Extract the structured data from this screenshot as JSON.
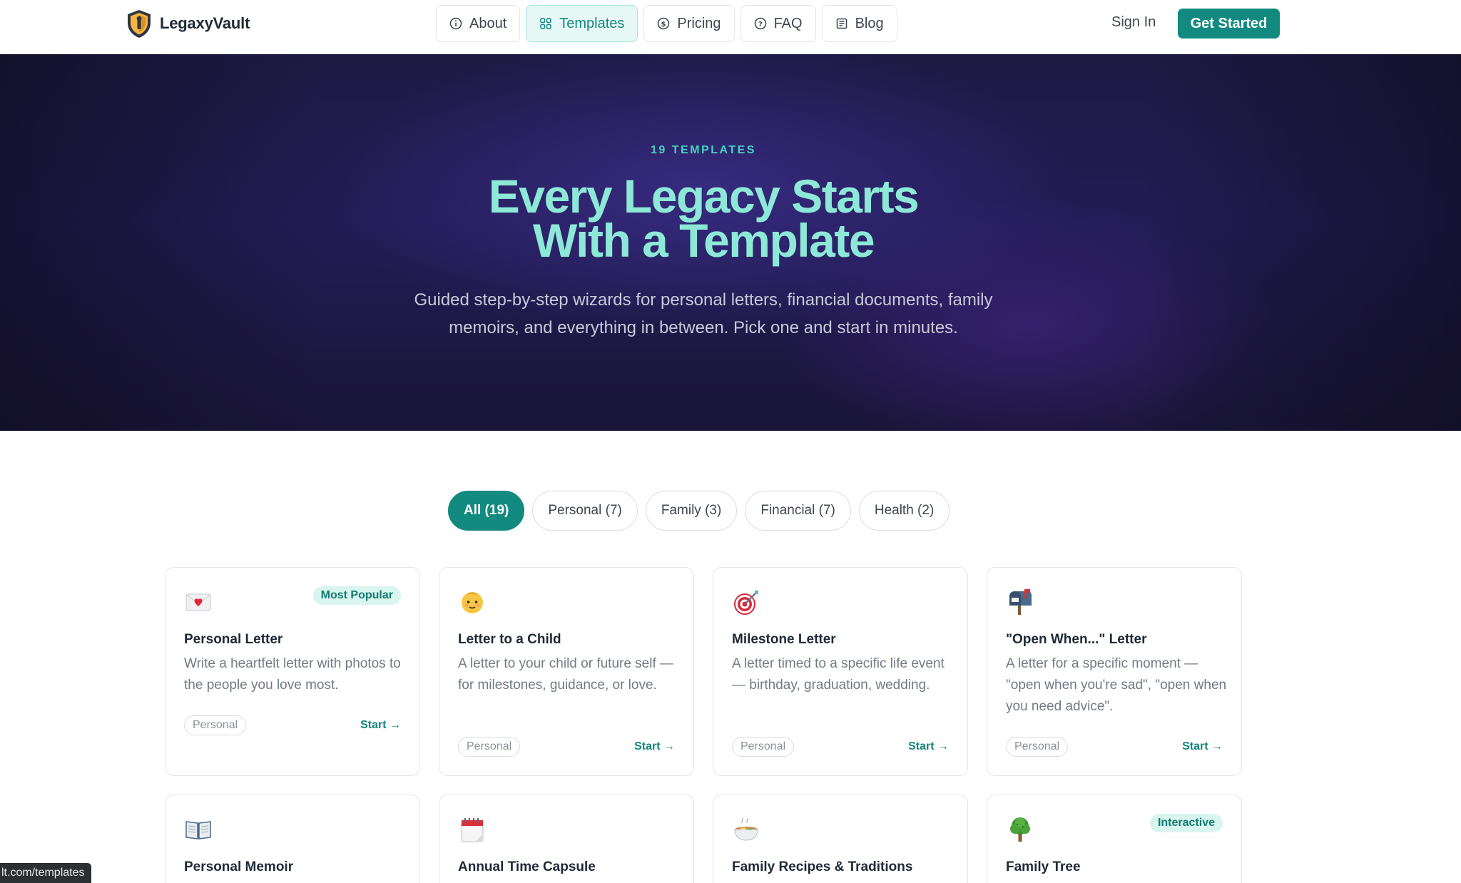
{
  "brand": {
    "name": "LegaxyVault"
  },
  "nav": {
    "links": [
      {
        "label": "About",
        "icon": "info-icon"
      },
      {
        "label": "Templates",
        "icon": "grid-icon"
      },
      {
        "label": "Pricing",
        "icon": "dollar-icon"
      },
      {
        "label": "FAQ",
        "icon": "help-circle-icon"
      },
      {
        "label": "Blog",
        "icon": "newspaper-icon"
      }
    ],
    "active": "Templates",
    "sign_in": "Sign In",
    "get_started": "Get Started"
  },
  "hero": {
    "eyebrow": "19 TEMPLATES",
    "title_line1": "Every Legacy Starts",
    "title_line2": "With a Template",
    "subtitle_line1": "Guided step-by-step wizards for personal letters, financial documents, family",
    "subtitle_line2": "memoirs, and everything in between. Pick one and start in minutes."
  },
  "filters": [
    "All (19)",
    "Personal (7)",
    "Family (3)",
    "Financial (7)",
    "Health (2)"
  ],
  "cards": [
    {
      "icon": "love-letter-icon",
      "title": "Personal Letter",
      "desc": "Write a heartfelt letter with photos to the people you love most.",
      "tag": "Personal",
      "badge": "Most Popular",
      "start": "Start →"
    },
    {
      "icon": "baby-icon",
      "title": "Letter to a Child",
      "desc": "A letter to your child or future self — for milestones, guidance, or love.",
      "tag": "Personal",
      "start": "Start →"
    },
    {
      "icon": "target-icon",
      "title": "Milestone Letter",
      "desc": "A letter timed to a specific life event — birthday, graduation, wedding.",
      "tag": "Personal",
      "start": "Start →"
    },
    {
      "icon": "mailbox-icon",
      "title": "\"Open When...\" Letter",
      "desc": "A letter for a specific moment — \"open when you're sad\", \"open when you need advice\".",
      "tag": "Personal",
      "start": "Start →"
    },
    {
      "icon": "open-book-icon",
      "title": "Personal Memoir",
      "desc": "",
      "tag": "",
      "start": ""
    },
    {
      "icon": "calendar-icon",
      "title": "Annual Time Capsule",
      "desc": "",
      "tag": "",
      "start": ""
    },
    {
      "icon": "bowl-icon",
      "title": "Family Recipes & Traditions",
      "desc": "",
      "tag": "",
      "start": ""
    },
    {
      "icon": "tree-icon",
      "title": "Family Tree",
      "desc": "",
      "tag": "",
      "badge": "Interactive",
      "start": ""
    }
  ],
  "status_bar": {
    "url": "lt.com/templates"
  }
}
